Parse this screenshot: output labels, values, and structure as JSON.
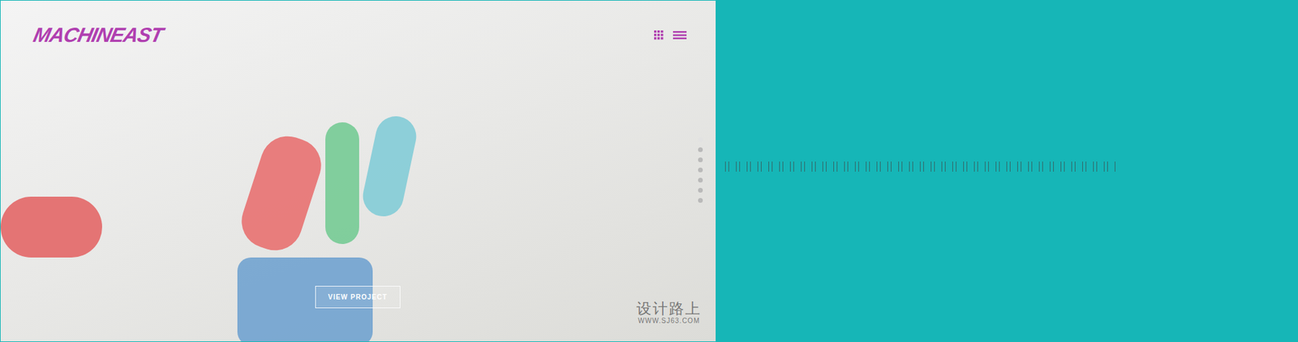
{
  "hero": {
    "logo": "MACHINEAST",
    "cta": "VIEW PROJECT",
    "slides": [
      {
        "selected": true
      },
      {
        "selected": false
      },
      {
        "selected": false
      },
      {
        "selected": false
      },
      {
        "selected": false
      },
      {
        "selected": false
      },
      {
        "selected": false
      }
    ]
  },
  "watermark": {
    "text": "设计路上",
    "url": "WWW.SJ63.COM"
  }
}
